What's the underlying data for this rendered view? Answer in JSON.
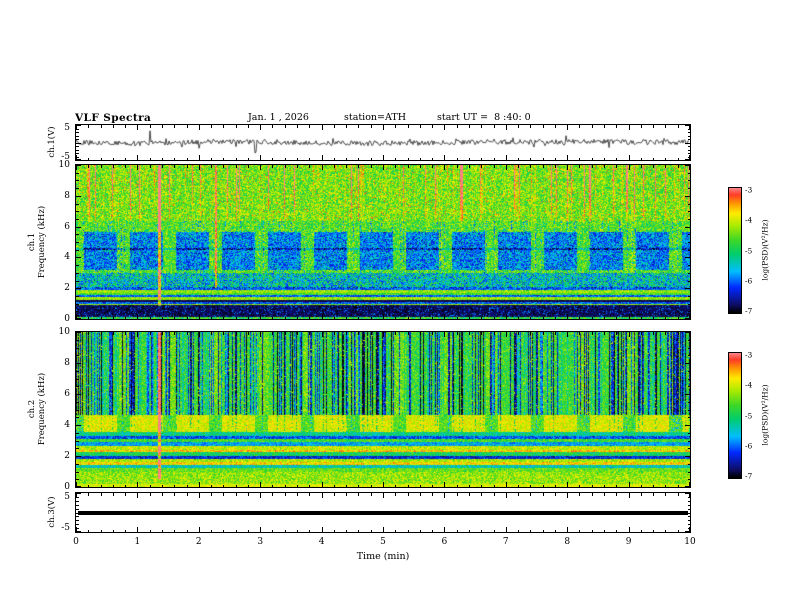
{
  "header": {
    "title": "VLF Spectra",
    "date": "Jan. 1 , 2026",
    "station": "station=ATH",
    "start_ut": "start UT =  8 :40: 0"
  },
  "xaxis": {
    "label": "Time (min)",
    "ticks": [
      "0",
      "1",
      "2",
      "3",
      "4",
      "5",
      "6",
      "7",
      "8",
      "9",
      "10"
    ],
    "range": [
      0,
      10
    ]
  },
  "colorbar": {
    "label": "log(PSD)(V²/Hz)",
    "ticks": [
      "-3",
      "-4",
      "-5",
      "-6",
      "-7"
    ],
    "range": [
      -7,
      -3
    ],
    "colormap": "rainbow (black-blue-cyan-green-yellow-red)"
  },
  "panels": {
    "ch1_wave": {
      "label": "ch.1(V)",
      "y_ticks": [
        "5",
        "-5"
      ],
      "ylim": [
        -5,
        5
      ]
    },
    "ch1_spec": {
      "ch_label": "ch.1",
      "freq_label": "Frequency (kHz)",
      "y_ticks": [
        "10",
        "8",
        "6",
        "4",
        "2",
        "0"
      ],
      "ylim_khz": [
        0,
        10
      ]
    },
    "ch2_spec": {
      "ch_label": "ch.2",
      "freq_label": "Frequency (kHz)",
      "y_ticks": [
        "10",
        "8",
        "6",
        "4",
        "2",
        "0"
      ],
      "ylim_khz": [
        0,
        10
      ]
    },
    "ch3_wave": {
      "label": "ch.3(V)",
      "y_ticks": [
        "5",
        "-5"
      ],
      "ylim": [
        -5,
        5
      ],
      "value": 0
    }
  },
  "chart_data": [
    {
      "panel": "ch1_waveform",
      "type": "line",
      "xlabel": "Time (min)",
      "x_range": [
        0,
        10
      ],
      "ylabel": "ch.1(V)",
      "ylim": [
        -5,
        5
      ],
      "description": "Broadband noisy voltage trace centered near 0 V with dense impulsive spikes reaching roughly ±4 V across the full 10 minutes"
    },
    {
      "panel": "ch1_spectrogram",
      "type": "heatmap",
      "x_range": [
        0,
        10
      ],
      "y_range_khz": [
        0,
        10
      ],
      "color_scale": {
        "label": "log(PSD)(V²/Hz)",
        "min": -7,
        "max": -3
      },
      "features": [
        "yellow/red vertical sferic streaks above ~7 kHz on a green background",
        "periodic dark-blue low-PSD patches between ~3 and 5.5 kHz repeating about every 0.75 min",
        "bluish noise band between ~2 and 3 kHz",
        "horizontal banded blue/green structure between ~0.9 and 2 kHz",
        "near-black very low PSD band below ~0.8 kHz",
        "strong broadband red streak near t ≈ 1.35 min"
      ]
    },
    {
      "panel": "ch2_spectrogram",
      "type": "heatmap",
      "x_range": [
        0,
        10
      ],
      "y_range_khz": [
        0,
        10
      ],
      "color_scale": {
        "label": "log(PSD)(V²/Hz)",
        "min": -7,
        "max": -3
      },
      "features": [
        "dense dark-blue vertical streaks over green background above ~4.5 kHz",
        "periodic yellow high-PSD patches near 3.5–4.5 kHz about every 0.75 min",
        "strong horizontal yellow/green/red interference lines between ~1 and 3.5 kHz",
        "green-yellow band below ~1 kHz",
        "broadband orange streak near t ≈ 1.35 min"
      ]
    },
    {
      "panel": "ch3_waveform",
      "type": "line",
      "x_range": [
        0,
        10
      ],
      "ylabel": "ch.3(V)",
      "ylim": [
        -5,
        5
      ],
      "description": "Constant thick black line at 0 V (flat, no signal)"
    }
  ]
}
